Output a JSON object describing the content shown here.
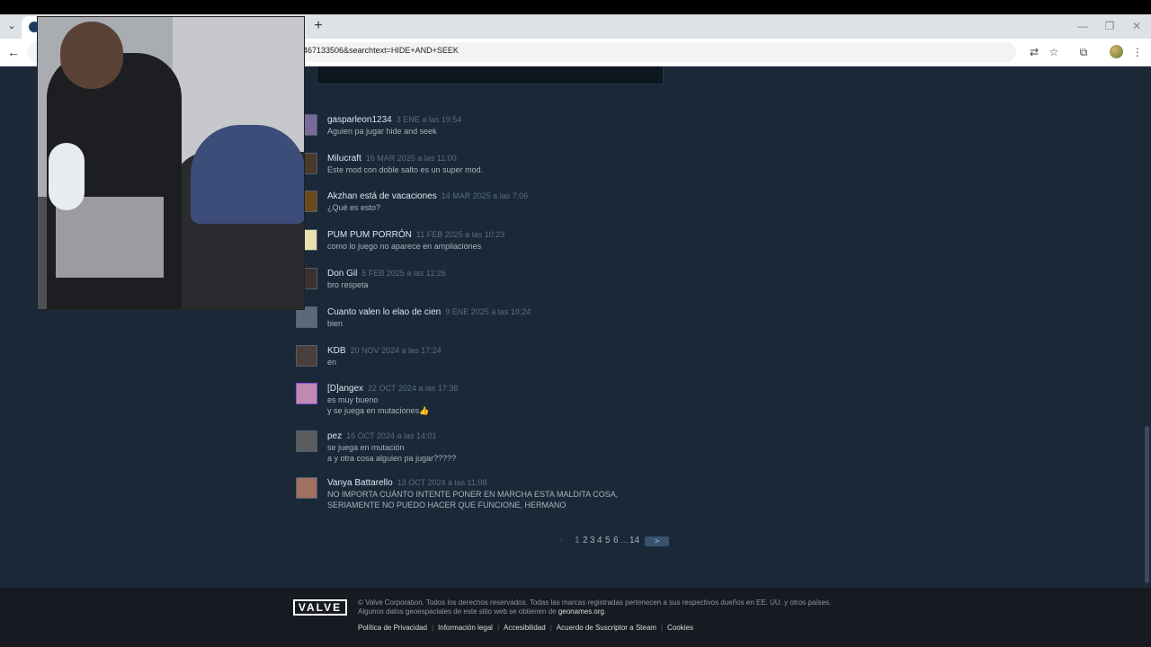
{
  "browser": {
    "url": "467133506&searchtext=HIDE+AND+SEEK",
    "new_tab_icon": "plus-icon",
    "tab_menu_icon": "chevron-down-icon"
  },
  "comments": [
    {
      "author": "gasparleon1234",
      "date": "3 ENE a las 19:54",
      "lines": [
        "Aguien pa jugar hide and seek"
      ]
    },
    {
      "author": "Milucraft",
      "date": "16 MAR 2025 a las 11:00",
      "lines": [
        "Este mod con doble salto es un super mod."
      ]
    },
    {
      "author": "Akzhan está de vacaciones",
      "date": "14 MAR 2025 a las 7:06",
      "lines": [
        "¿Qué es esto?"
      ]
    },
    {
      "author": "PUM PUM PORRÓN",
      "date": "11 FEB 2025 a las 10:23",
      "lines": [
        "como lo juego no aparece en ampliaciones"
      ]
    },
    {
      "author": "Don Gil",
      "date": "5 FEB 2025 a las 11:26",
      "lines": [
        "bro respeta"
      ]
    },
    {
      "author": "Cuanto valen lo elao de cien",
      "date": "9 ENE 2025 a las 19:24",
      "lines": [
        "bien"
      ]
    },
    {
      "author": "KDB",
      "date": "20 NOV 2024 a las 17:24",
      "lines": [
        "en"
      ]
    },
    {
      "author": "[D]angex",
      "date": "22 OCT 2024 a las 17:38",
      "lines": [
        "es muy bueno",
        "y se juega en mutaciones👍"
      ]
    },
    {
      "author": "pez",
      "date": "16 OCT 2024 a las 14:01",
      "lines": [
        "se juega en mutación",
        "a y otra cosa alguien pa jugar?????"
      ]
    },
    {
      "author": "Vanya Battarello",
      "date": "13 OCT 2024 a las 11:08",
      "lines": [
        "NO IMPORTA CUÁNTO INTENTE PONER EN MARCHA ESTA MALDITA COSA,",
        "SERIAMENTE NO PUEDO HACER QUE FUNCIONE, HERMANO"
      ]
    }
  ],
  "pagination": {
    "prev": "<",
    "pages": [
      "1",
      "2",
      "3",
      "4",
      "5",
      "6"
    ],
    "ellipsis": "...",
    "last": "14",
    "next": ">"
  },
  "footer": {
    "logo": "VALVE",
    "line1": "© Valve Corporation. Todos los derechos reservados. Todas las marcas registradas pertenecen a sus respectivos dueños en EE. UU. y otros países.",
    "line2_prefix": "Algunos datos geoespaciales de este sitio web se obtienen de ",
    "line2_link": "geonames.org",
    "line2_suffix": ".",
    "links": [
      "Política de Privacidad",
      "Información legal",
      "Accesibilidad",
      "Acuerdo de Suscriptor a Steam",
      "Cookies"
    ]
  }
}
